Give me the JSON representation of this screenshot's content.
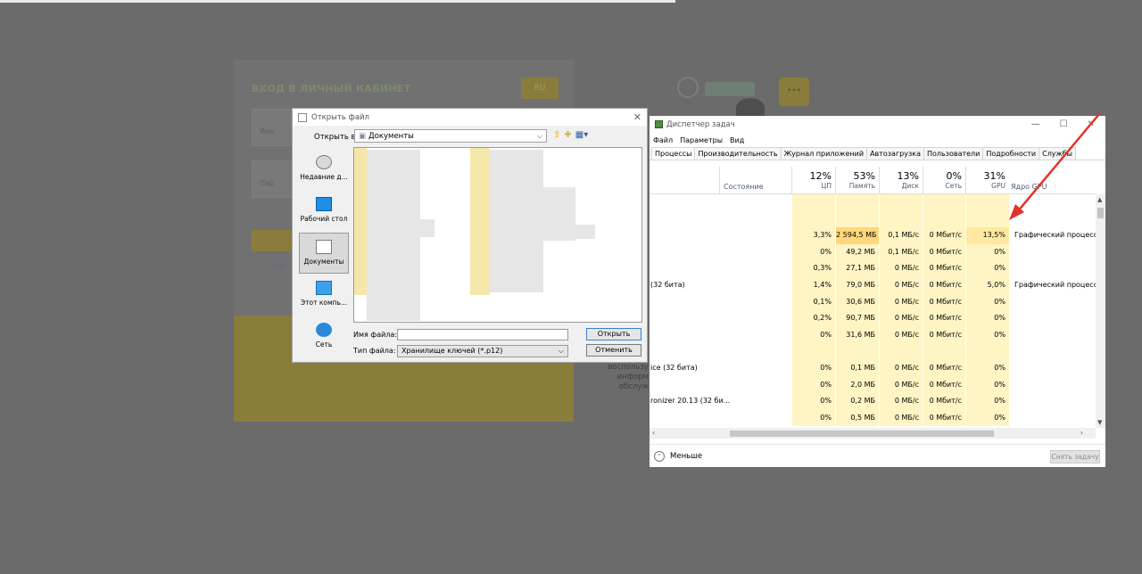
{
  "background_page": {
    "login_title": "ВХОД В ЛИЧНЫЙ КАБИНЕТ",
    "lang_button": "RU",
    "login_placeholder": "Инн",
    "password_placeholder": "Пар",
    "register_link": "Рег",
    "side_text_1": "воспользу",
    "side_text_2": "информ",
    "side_text_3": "обслуж",
    "bubble_text": "•••"
  },
  "open_file_dialog": {
    "title": "Открыть файл",
    "look_in_label": "Открыть в:",
    "look_in_value": "Документы",
    "places": [
      {
        "label": "Недавние д..."
      },
      {
        "label": "Рабочий стол"
      },
      {
        "label": "Документы"
      },
      {
        "label": "Этот компь..."
      },
      {
        "label": "Сеть"
      }
    ],
    "file_name_label": "Имя файла:",
    "file_name_value": "",
    "file_type_label": "Тип файла:",
    "file_type_value": "Хранилище ключей (*.p12)",
    "open_button": "Открыть",
    "cancel_button": "Отменить",
    "close_glyph": "✕"
  },
  "task_manager": {
    "title": "Диспетчер задач",
    "window_controls": {
      "minimize": "—",
      "maximize": "☐",
      "close": "✕"
    },
    "menu": [
      "Файл",
      "Параметры",
      "Вид"
    ],
    "tabs": [
      "Процессы",
      "Производительность",
      "Журнал приложений",
      "Автозагрузка",
      "Пользователи",
      "Подробности",
      "Службы"
    ],
    "columns": {
      "state": "Состояние",
      "cpu": {
        "pct": "12%",
        "label": "ЦП"
      },
      "memory": {
        "pct": "53%",
        "label": "Память"
      },
      "disk": {
        "pct": "13%",
        "label": "Диск"
      },
      "network": {
        "pct": "0%",
        "label": "Сеть"
      },
      "gpu": {
        "pct": "31%",
        "label": "GPU"
      },
      "gpu_engine": "Ядро GPU"
    },
    "rows": [
      {
        "name": "",
        "cpu": "",
        "mem": "",
        "disk": "",
        "net": "",
        "gpu": "",
        "engine": ""
      },
      {
        "name": "",
        "cpu": "",
        "mem": "",
        "disk": "",
        "net": "",
        "gpu": "",
        "engine": ""
      },
      {
        "name": "",
        "cpu": "3,3%",
        "mem": "2 594,5 МБ",
        "disk": "0,1 МБ/с",
        "net": "0 Мбит/с",
        "gpu": "13,5%",
        "engine": "Графический процессор"
      },
      {
        "name": "",
        "cpu": "0%",
        "mem": "49,2 МБ",
        "disk": "0,1 МБ/с",
        "net": "0 Мбит/с",
        "gpu": "0%",
        "engine": ""
      },
      {
        "name": "",
        "cpu": "0,3%",
        "mem": "27,1 МБ",
        "disk": "0 МБ/с",
        "net": "0 Мбит/с",
        "gpu": "0%",
        "engine": ""
      },
      {
        "name": "(32 бита)",
        "cpu": "1,4%",
        "mem": "79,0 МБ",
        "disk": "0 МБ/с",
        "net": "0 Мбит/с",
        "gpu": "5,0%",
        "engine": "Графический процессор"
      },
      {
        "name": "",
        "cpu": "0,1%",
        "mem": "30,6 МБ",
        "disk": "0 МБ/с",
        "net": "0 Мбит/с",
        "gpu": "0%",
        "engine": ""
      },
      {
        "name": "",
        "cpu": "0,2%",
        "mem": "90,7 МБ",
        "disk": "0 МБ/с",
        "net": "0 Мбит/с",
        "gpu": "0%",
        "engine": ""
      },
      {
        "name": "",
        "cpu": "0%",
        "mem": "31,6 МБ",
        "disk": "0 МБ/с",
        "net": "0 Мбит/с",
        "gpu": "0%",
        "engine": ""
      },
      {
        "name": "",
        "cpu": "",
        "mem": "",
        "disk": "",
        "net": "",
        "gpu": "",
        "engine": ""
      },
      {
        "name": "ice (32 бита)",
        "cpu": "0%",
        "mem": "0,1 МБ",
        "disk": "0 МБ/с",
        "net": "0 Мбит/с",
        "gpu": "0%",
        "engine": ""
      },
      {
        "name": "",
        "cpu": "0%",
        "mem": "2,0 МБ",
        "disk": "0 МБ/с",
        "net": "0 Мбит/с",
        "gpu": "0%",
        "engine": ""
      },
      {
        "name": "ronizer 20.13 (32 би...",
        "cpu": "0%",
        "mem": "0,2 МБ",
        "disk": "0 МБ/с",
        "net": "0 Мбит/с",
        "gpu": "0%",
        "engine": ""
      },
      {
        "name": "",
        "cpu": "0%",
        "mem": "0,5 МБ",
        "disk": "0 МБ/с",
        "net": "0 Мбит/с",
        "gpu": "0%",
        "engine": ""
      }
    ],
    "less_label": "Меньше",
    "end_task_button": "Снять задачу"
  },
  "colors": {
    "heat_light": "#fff4c4",
    "heat_mid": "#ffe9a0",
    "heat_strong": "#ffd87a",
    "arrow": "#e0342a"
  }
}
